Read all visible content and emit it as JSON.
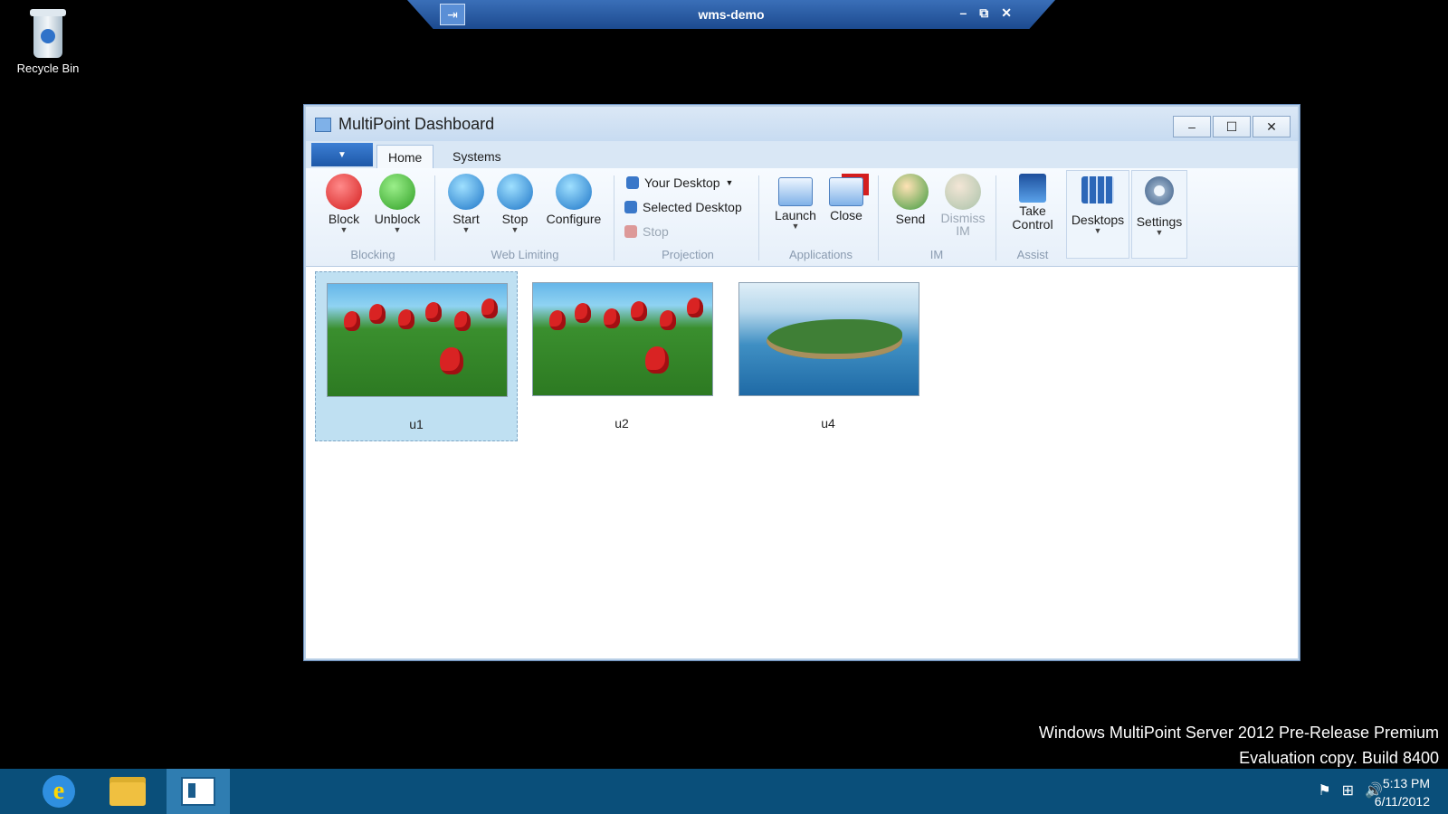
{
  "remote_bar": {
    "title": "wms-demo",
    "pin": "⇥",
    "min": "–",
    "restore": "⧉",
    "close": "✕"
  },
  "desktop": {
    "recycle_bin": "Recycle Bin"
  },
  "window": {
    "title": "MultiPoint Dashboard",
    "controls": {
      "min": "–",
      "max": "☐",
      "close": "✕"
    },
    "app_menu": "▼",
    "tabs": [
      {
        "label": "Home"
      },
      {
        "label": "Systems"
      }
    ]
  },
  "ribbon": {
    "blocking": {
      "label": "Blocking",
      "block": "Block",
      "unblock": "Unblock"
    },
    "web_limiting": {
      "label": "Web Limiting",
      "start": "Start",
      "stop": "Stop",
      "configure": "Configure"
    },
    "projection": {
      "label": "Projection",
      "your_desktop": "Your Desktop",
      "selected_desktop": "Selected Desktop",
      "stop": "Stop"
    },
    "applications": {
      "label": "Applications",
      "launch": "Launch",
      "close": "Close"
    },
    "im": {
      "label": "IM",
      "send": "Send",
      "dismiss_line1": "Dismiss",
      "dismiss_line2": "IM"
    },
    "assist": {
      "label": "Assist",
      "take_line1": "Take",
      "take_line2": "Control"
    },
    "desktops": "Desktops",
    "settings": "Settings"
  },
  "thumbnails": [
    {
      "label": "u1",
      "selected": true
    },
    {
      "label": "u2",
      "selected": false
    },
    {
      "label": "u4",
      "selected": false
    }
  ],
  "watermark": {
    "line1": "Windows MultiPoint Server 2012 Pre-Release Premium",
    "line2": "Evaluation copy. Build 8400"
  },
  "taskbar": {
    "ie_glyph": "e",
    "clock_time": "5:13 PM",
    "clock_date": "6/11/2012",
    "tray": {
      "flag": "⚑",
      "network": "⊞",
      "volume": "🔊"
    }
  }
}
